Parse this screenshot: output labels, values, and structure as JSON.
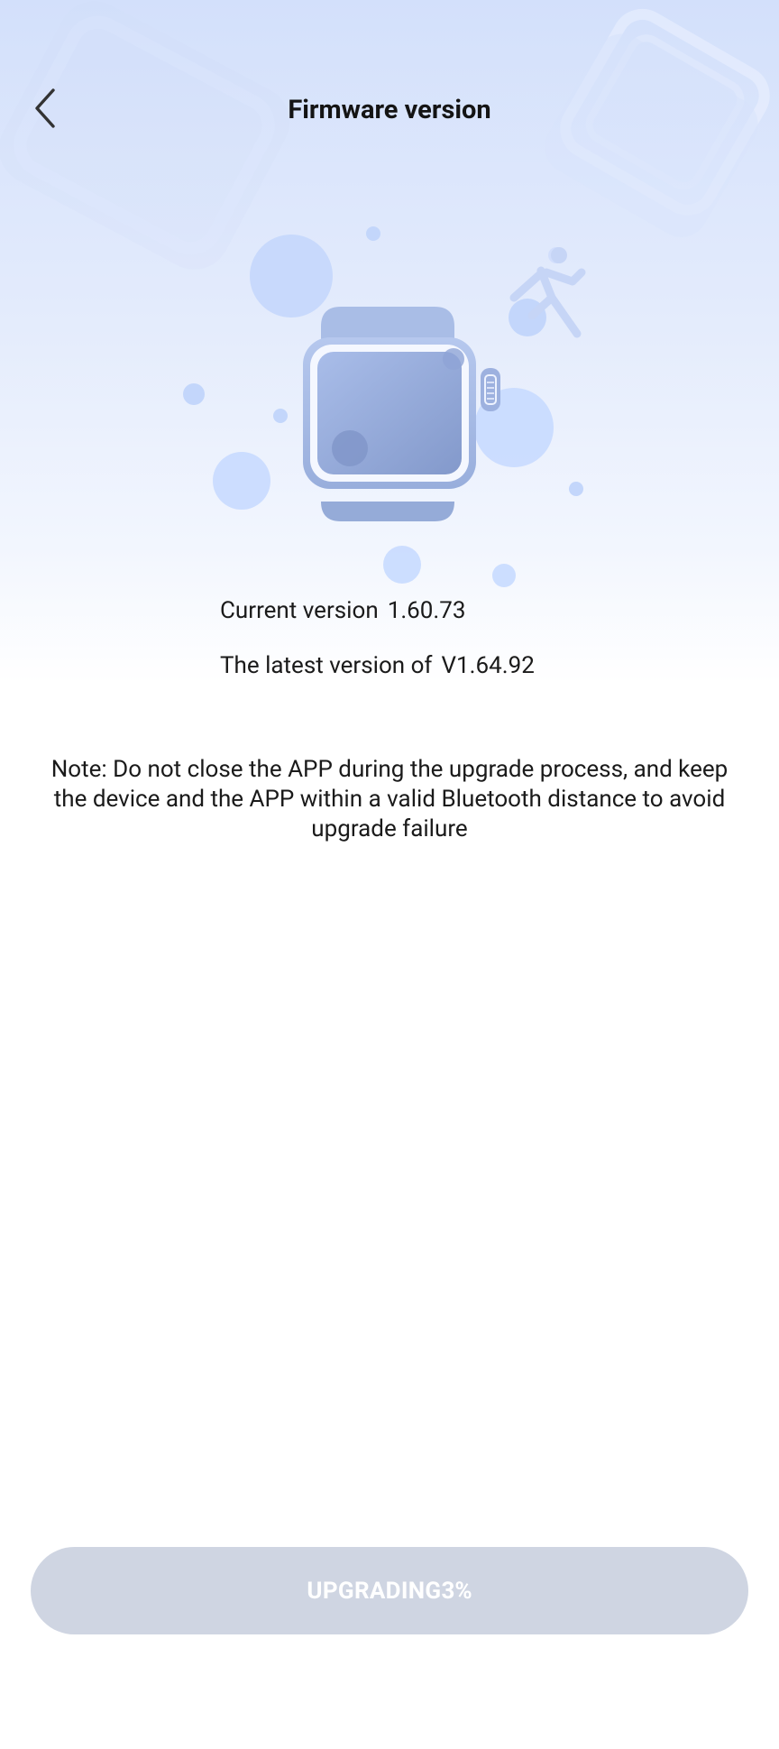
{
  "header": {
    "title": "Firmware version",
    "back_icon": "chevron-left-icon"
  },
  "illustration": {
    "watch_icon": "smartwatch-icon",
    "runner_icon": "running-person-icon",
    "colors": {
      "watch_body": "#a9bde6",
      "watch_screen": "#8da3d2",
      "bubble": "#c3d6fb"
    }
  },
  "versions": {
    "current_label": "Current version",
    "current_value": "1.60.73",
    "latest_label": "The latest version of",
    "latest_value": "V1.64.92"
  },
  "note": "Note: Do not close the APP during the upgrade process, and keep the device and the APP within a valid Bluetooth distance to avoid upgrade failure",
  "upgrade": {
    "label": "UPGRADING",
    "progress": "3%",
    "progress_value": 0.03,
    "disabled": true,
    "background": "#cfd5e2"
  }
}
